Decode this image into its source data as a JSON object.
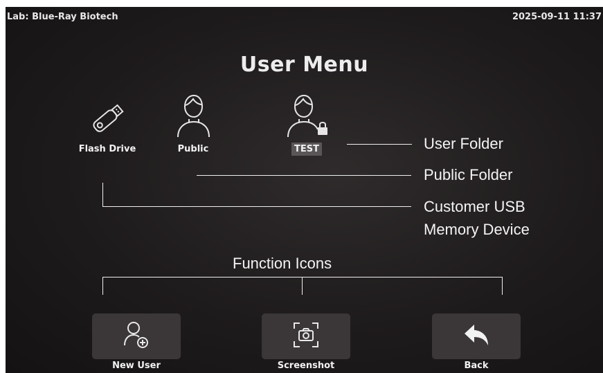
{
  "header": {
    "lab": "Lab: Blue-Ray Biotech",
    "datetime": "2025-09-11 11:37"
  },
  "title": "User Menu",
  "folders": [
    {
      "label": "Flash Drive",
      "icon": "flash-drive-icon"
    },
    {
      "label": "Public",
      "icon": "user-icon"
    },
    {
      "label": "TEST",
      "icon": "locked-user-icon",
      "selected": true
    }
  ],
  "function_buttons": [
    {
      "label": "New User",
      "icon": "add-user-icon"
    },
    {
      "label": "Screenshot",
      "icon": "camera-icon"
    },
    {
      "label": "Back",
      "icon": "back-arrow-icon"
    }
  ],
  "callouts": {
    "user_folder": "User Folder",
    "public_folder": "Public Folder",
    "usb_line1": "Customer USB",
    "usb_line2": "Memory Device",
    "function_icons": "Function Icons"
  },
  "colors": {
    "background": "#1e1b1c",
    "button": "#3b3738",
    "selected_label": "#5a5556",
    "text": "#f2f2f2"
  }
}
